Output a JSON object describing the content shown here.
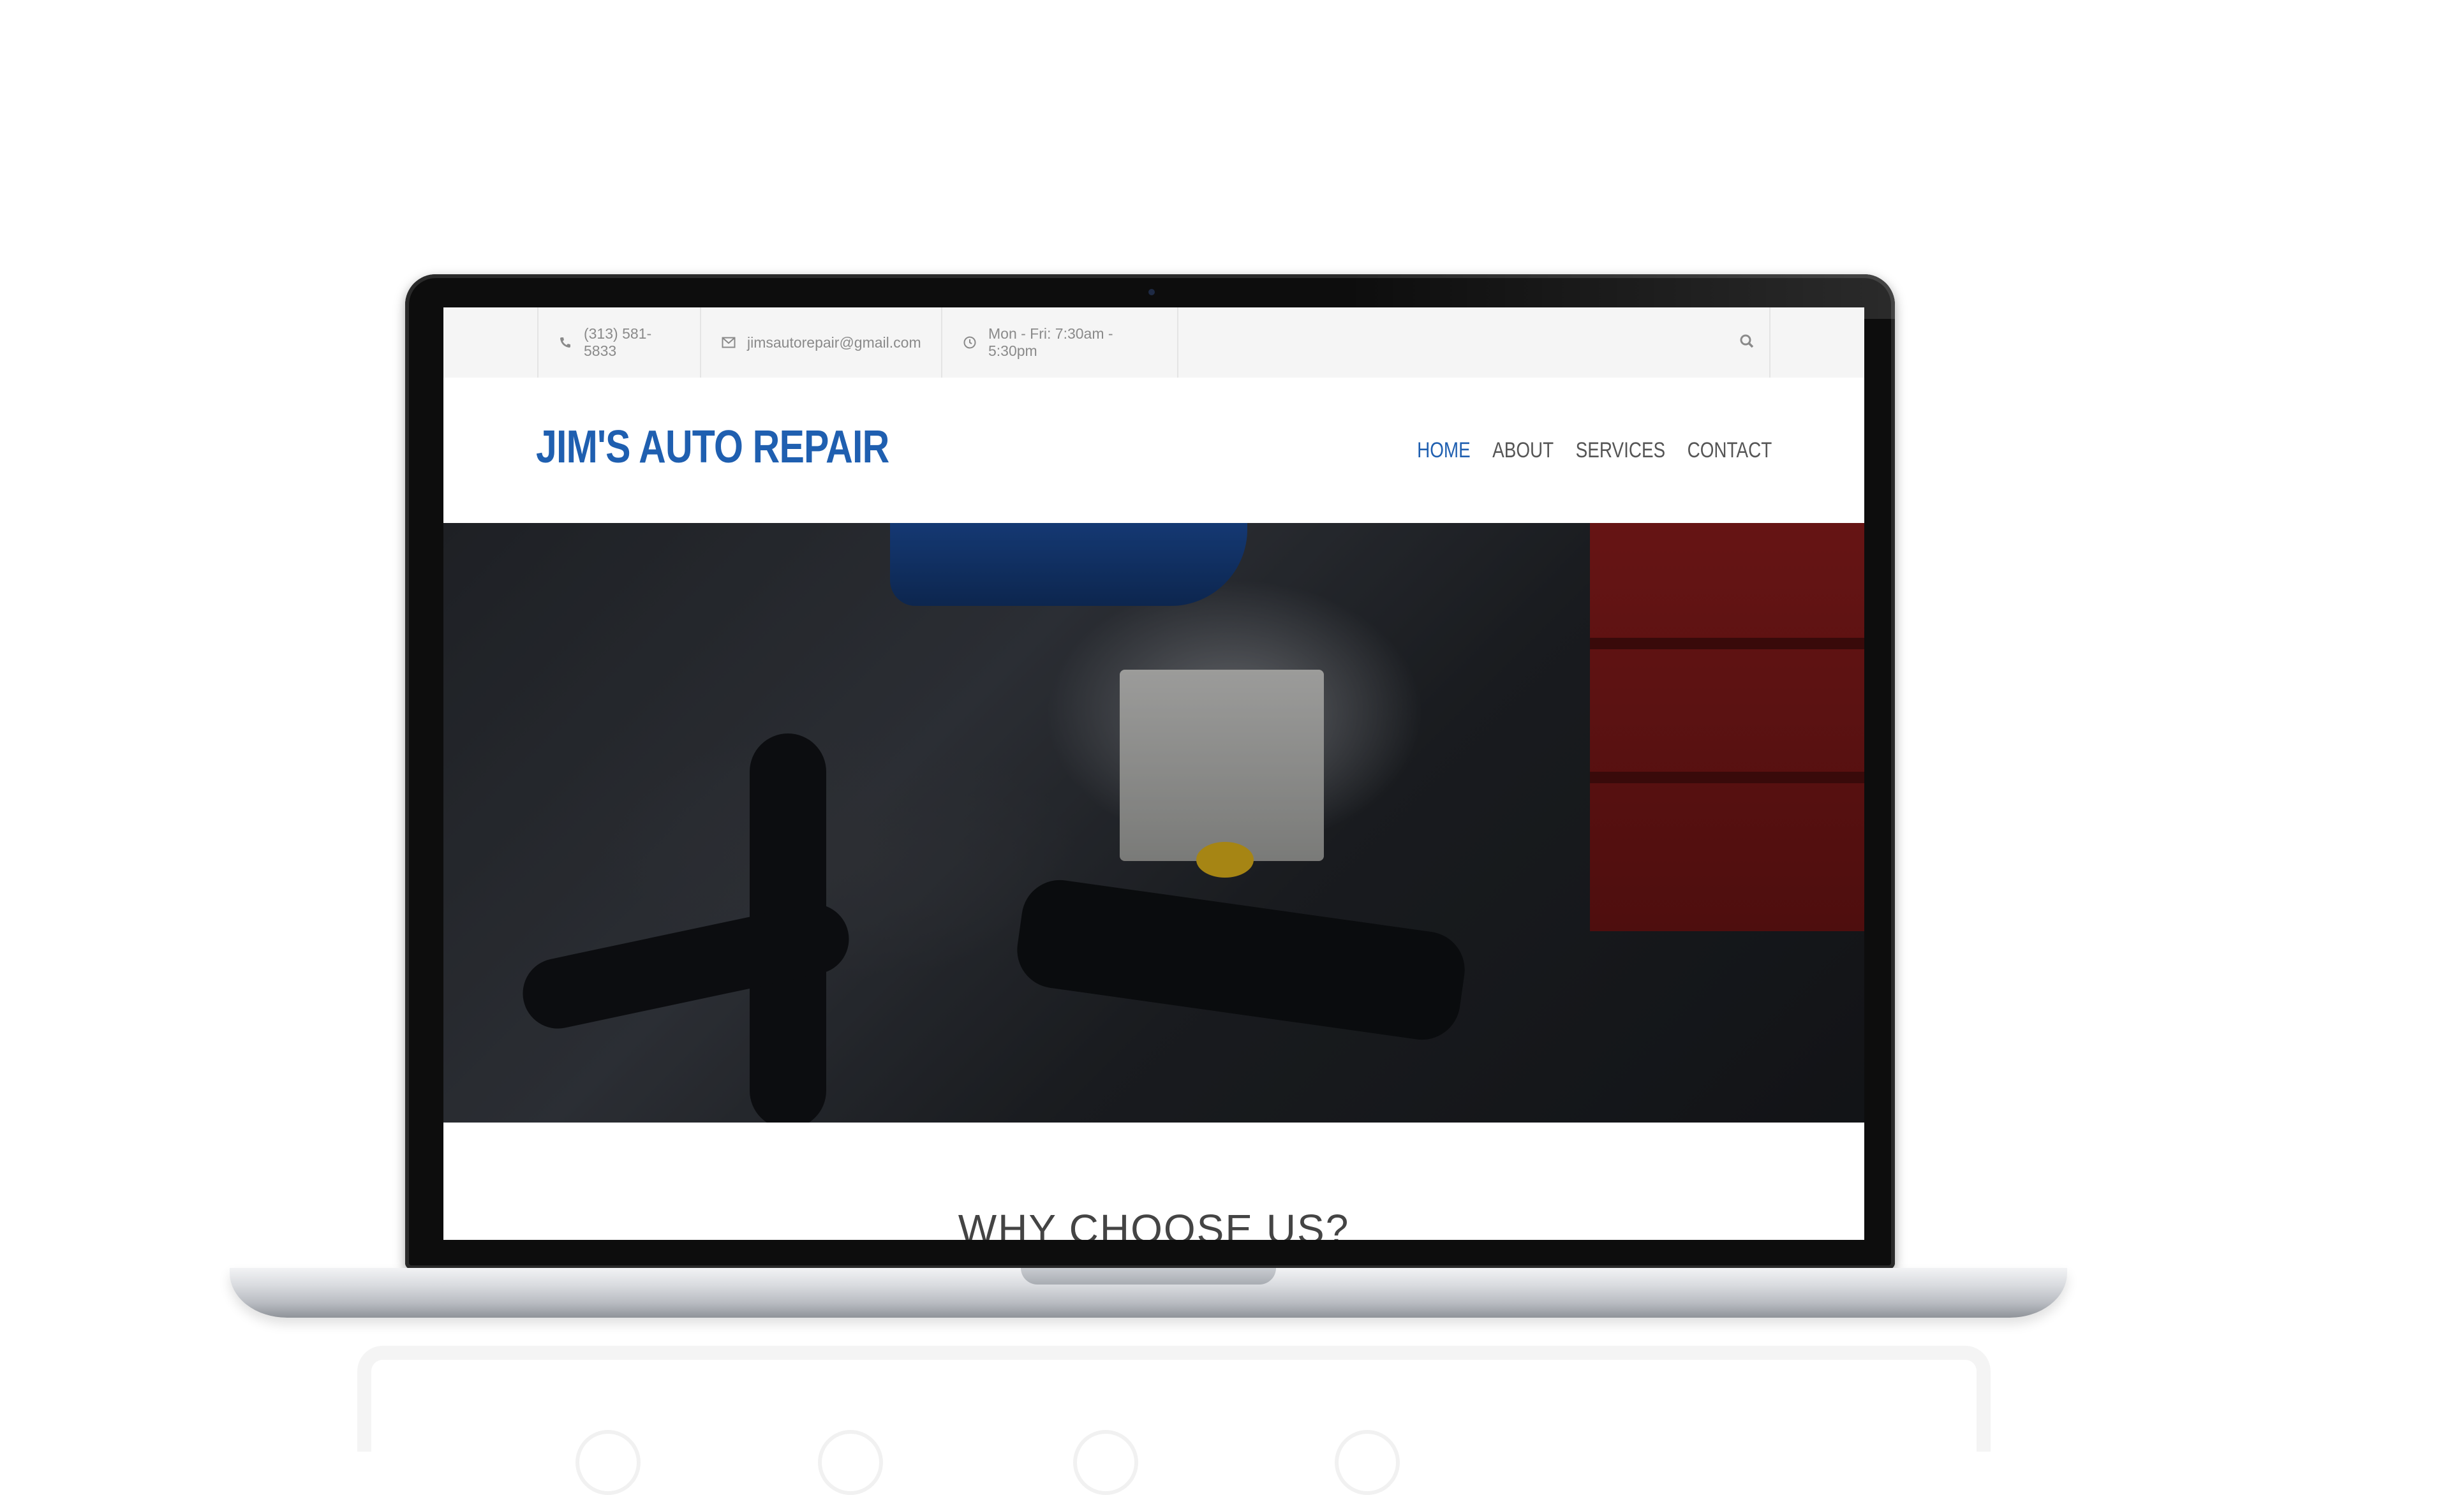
{
  "topbar": {
    "phone": "(313) 581-5833",
    "email": "jimsautorepair@gmail.com",
    "hours": "Mon - Fri: 7:30am - 5:30pm",
    "icons": [
      "phone-icon",
      "envelope-icon",
      "clock-icon",
      "search-icon"
    ]
  },
  "brand": {
    "name": "JIM'S AUTO REPAIR",
    "color": "#1f5fb0"
  },
  "nav": {
    "items": [
      {
        "label": "HOME",
        "active": true
      },
      {
        "label": "ABOUT",
        "active": false
      },
      {
        "label": "SERVICES",
        "active": false
      },
      {
        "label": "CONTACT",
        "active": false
      }
    ]
  },
  "section": {
    "title": "WHY CHOOSE US?"
  }
}
